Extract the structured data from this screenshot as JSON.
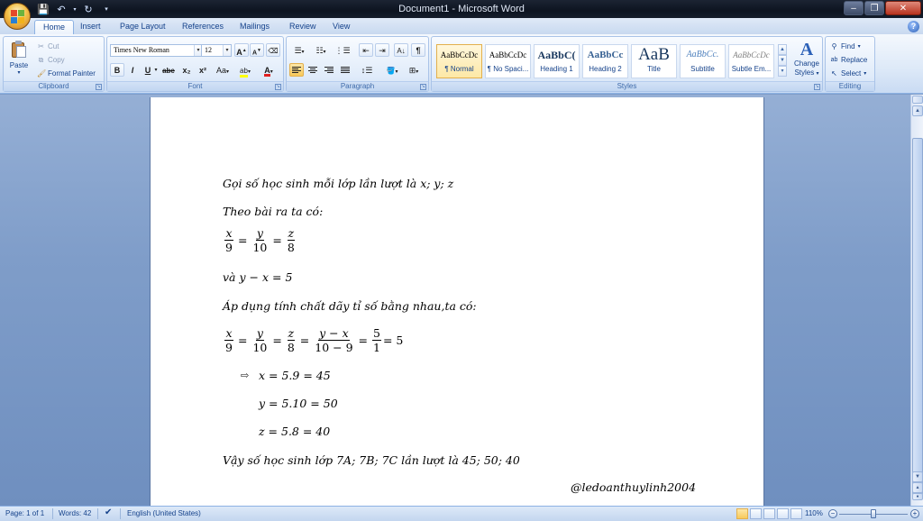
{
  "window": {
    "title": "Document1 - Microsoft Word"
  },
  "tabs": [
    "Home",
    "Insert",
    "Page Layout",
    "References",
    "Mailings",
    "Review",
    "View"
  ],
  "active_tab": "Home",
  "ribbon": {
    "clipboard": {
      "label": "Clipboard",
      "paste": "Paste",
      "cut": "Cut",
      "copy": "Copy",
      "format_painter": "Format Painter"
    },
    "font": {
      "label": "Font",
      "font_name": "Times New Roman",
      "font_size": "12",
      "bold": "B",
      "italic": "I",
      "underline": "U",
      "strike": "abe",
      "subscript": "x₂",
      "superscript": "x²",
      "change_case": "Aa",
      "grow": "A",
      "shrink": "A"
    },
    "paragraph": {
      "label": "Paragraph"
    },
    "styles": {
      "label": "Styles",
      "items": [
        {
          "sample": "AaBbCcDc",
          "name": "¶ Normal"
        },
        {
          "sample": "AaBbCcDc",
          "name": "¶ No Spaci..."
        },
        {
          "sample": "AaBbC(",
          "name": "Heading 1"
        },
        {
          "sample": "AaBbCc",
          "name": "Heading 2"
        },
        {
          "sample": "AaB",
          "name": "Title"
        },
        {
          "sample": "AaBbCc.",
          "name": "Subtitle"
        },
        {
          "sample": "AaBbCcDc",
          "name": "Subtle Em..."
        }
      ],
      "change_styles_line1": "Change",
      "change_styles_line2": "Styles"
    },
    "editing": {
      "label": "Editing",
      "find": "Find",
      "replace": "Replace",
      "select": "Select"
    }
  },
  "document": {
    "line1": "Gọi số học sinh  mỗi lớp lần lượt là x; y; z",
    "line2": "Theo bài ra ta có:",
    "eq1": {
      "n1": "x",
      "d1": "9",
      "n2": "y",
      "d2": "10",
      "n3": "z",
      "d3": "8"
    },
    "line4_pre": "và ",
    "line4_math": "y − x = 5",
    "line5": "Áp dụng tính chất dãy tỉ số bằng nhau,ta có:",
    "eq2": {
      "n1": "x",
      "d1": "9",
      "n2": "y",
      "d2": "10",
      "n3": "z",
      "d3": "8",
      "n4": "y − x",
      "d4": "10 − 9",
      "n5": "5",
      "d5": "1",
      "result": "= 5"
    },
    "bullet": "⇨",
    "sol_x": "x = 5.9 = 45",
    "sol_y": "y = 5.10 = 50",
    "sol_z": "z = 5.8 = 40",
    "conclusion": "Vậy số học sinh  lớp 7A; 7B; 7C lần lượt là 45; 50; 40",
    "signature": "@ledoanthuylinh2004"
  },
  "statusbar": {
    "page": "Page: 1 of 1",
    "words": "Words: 42",
    "language": "English (United States)",
    "zoom": "110%"
  }
}
